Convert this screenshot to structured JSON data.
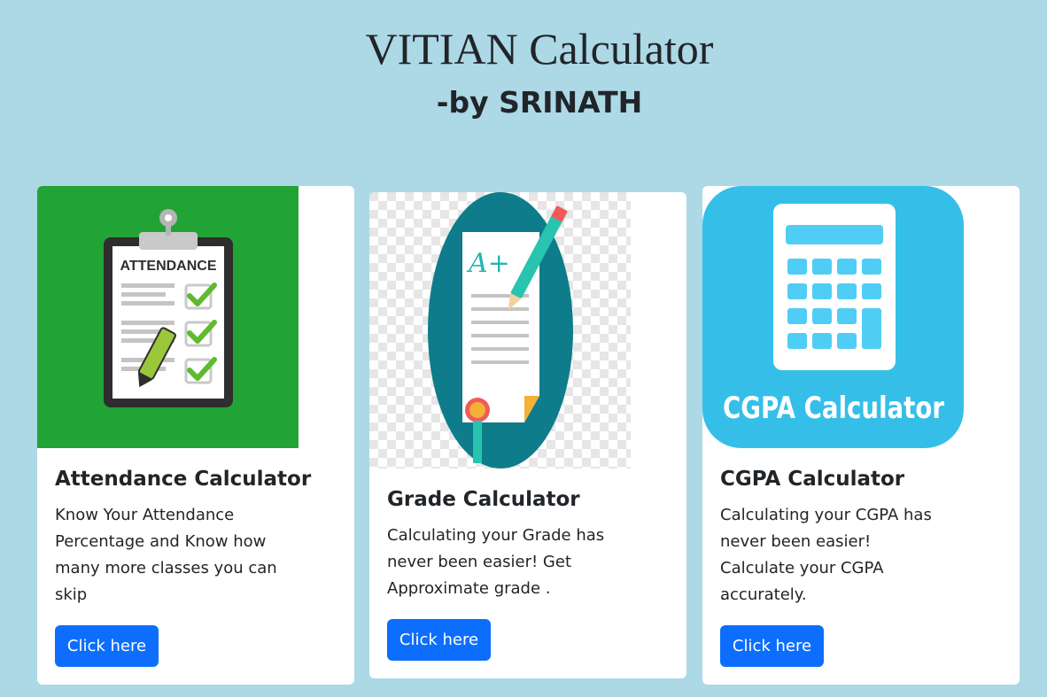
{
  "header": {
    "title": "VITIAN Calculator",
    "subtitle": "-by SRINATH"
  },
  "cards": [
    {
      "title": "Attendance Calculator",
      "text": "Know Your Attendance Percentage and Know how many more classes you can skip",
      "button_label": "Click here",
      "image": {
        "icon": "attendance-clipboard-icon",
        "heading": "ATTENDANCE",
        "background": "#22a336"
      }
    },
    {
      "title": "Grade Calculator",
      "text": "Calculating your Grade has never been easier! Get Approximate grade .",
      "button_label": "Click here",
      "image": {
        "icon": "grade-paper-icon",
        "mark": "A+",
        "background": "#0e7c8a"
      }
    },
    {
      "title": "CGPA Calculator",
      "text": "Calculating your CGPA has never been easier! Calculate your CGPA accurately.",
      "extra_text": ".",
      "button_label": "Click here",
      "image": {
        "icon": "cgpa-calculator-icon",
        "label": "CGPA Calculator",
        "background": "#35bfe8"
      }
    }
  ],
  "colors": {
    "page_background": "#add8e6",
    "button": "#0d6efd",
    "card": "#ffffff"
  }
}
